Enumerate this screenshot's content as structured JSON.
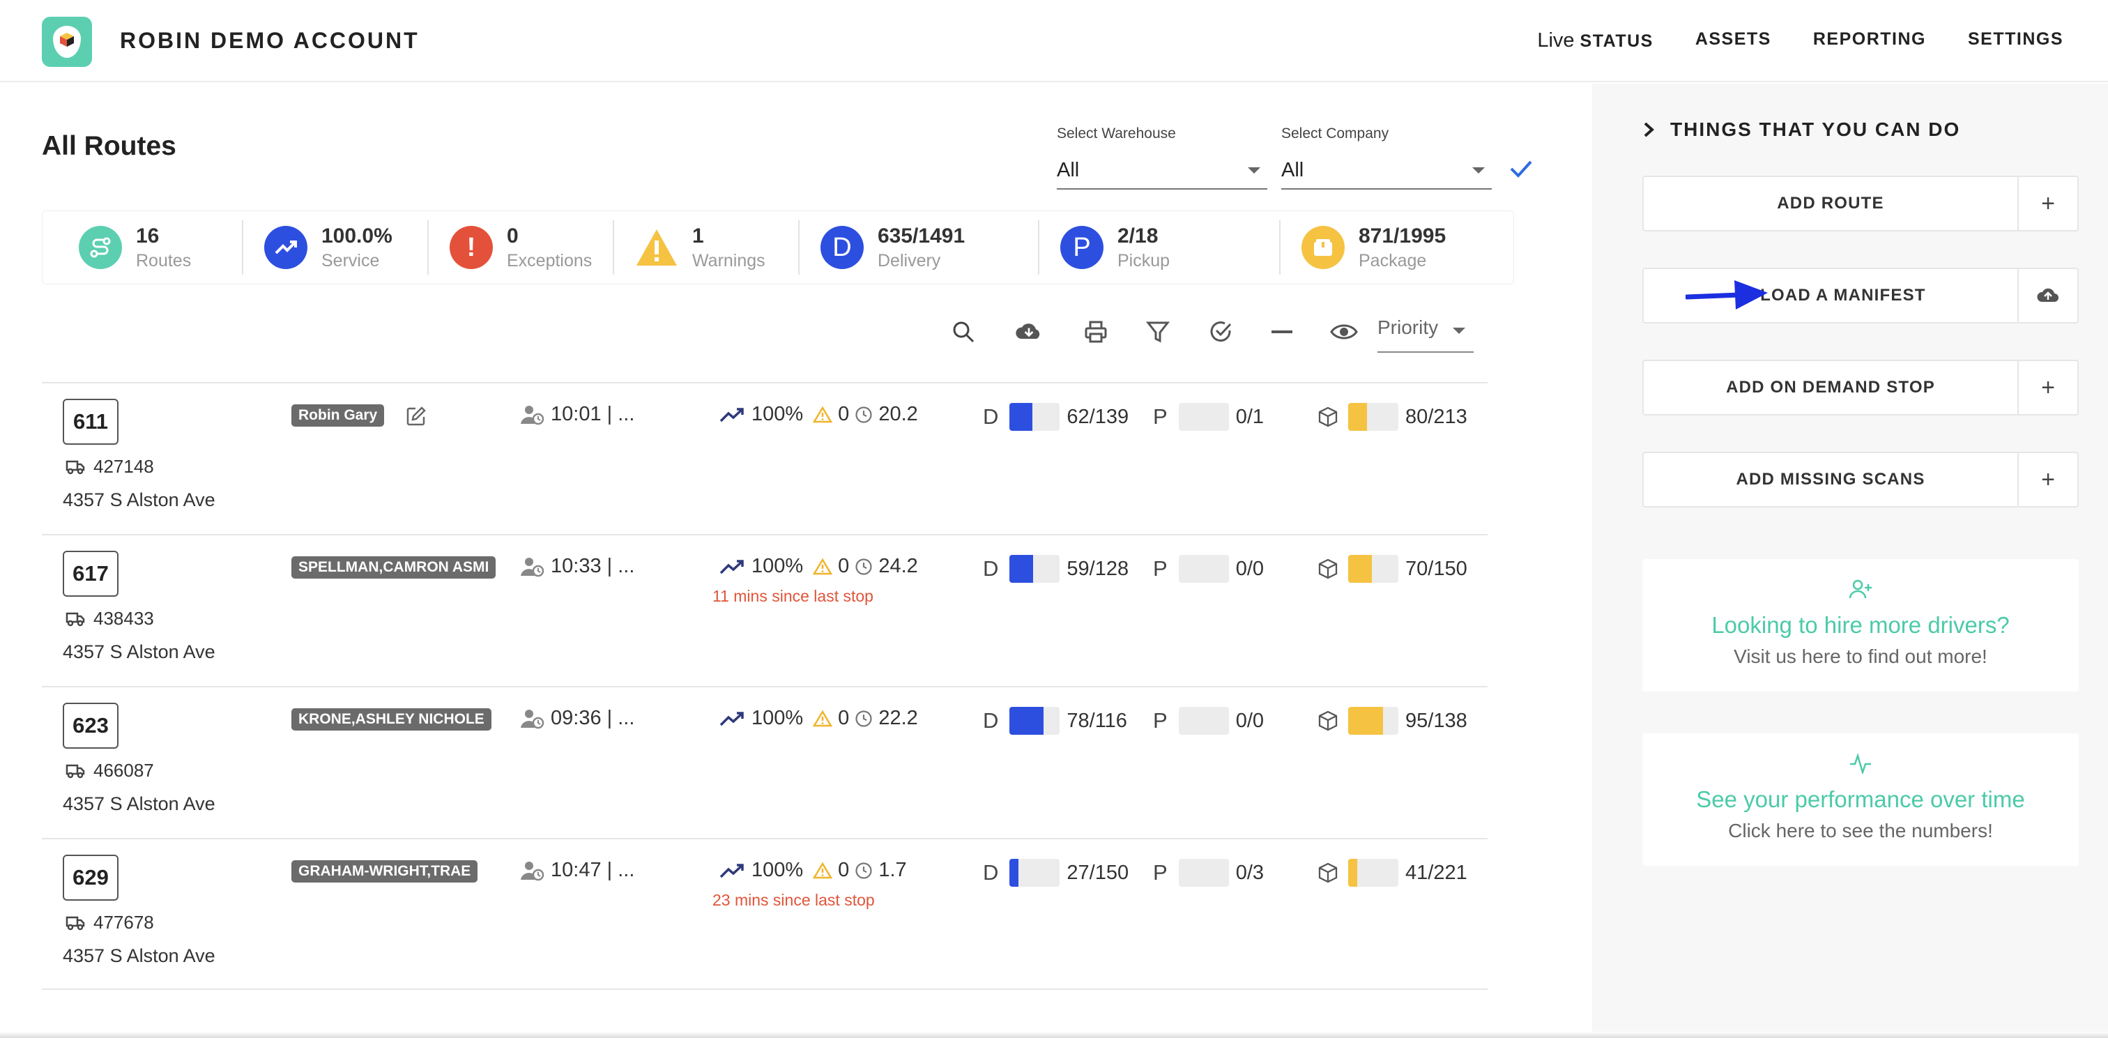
{
  "header": {
    "brand": "ROBIN DEMO ACCOUNT",
    "nav_live_prefix": "Live",
    "nav": [
      "STATUS",
      "ASSETS",
      "REPORTING",
      "SETTINGS"
    ]
  },
  "main": {
    "title": "All Routes",
    "warehouse": {
      "label": "Select Warehouse",
      "value": "All"
    },
    "company": {
      "label": "Select Company",
      "value": "All"
    },
    "priority": "Priority"
  },
  "stats": [
    {
      "value": "16",
      "label": "Routes",
      "icon": "route-icon",
      "color": "#5ccfb1"
    },
    {
      "value": "100.0%",
      "label": "Service",
      "icon": "trending-up-icon",
      "color": "#2d4fe0"
    },
    {
      "value": "0",
      "label": "Exceptions",
      "icon": "exclamation-icon",
      "color": "#e4513a"
    },
    {
      "value": "1",
      "label": "Warnings",
      "icon": "warning-icon",
      "color": "#f5c242"
    },
    {
      "value": "635/1491",
      "label": "Delivery",
      "icon": "D",
      "color": "#2d4fe0"
    },
    {
      "value": "2/18",
      "label": "Pickup",
      "icon": "P",
      "color": "#2d4fe0"
    },
    {
      "value": "871/1995",
      "label": "Package",
      "icon": "package-icon",
      "color": "#f5c242"
    }
  ],
  "rows": [
    {
      "route": "611",
      "truck": "427148",
      "address": "4357 S Alston Ave",
      "driver": "Robin Gary",
      "time": "10:01 | ...",
      "service": "100%",
      "warnings": "0",
      "hours": "20.2",
      "since": "",
      "delivery_letter": "D",
      "delivery": "62/139",
      "delivery_pct": 0.446,
      "pickup_letter": "P",
      "pickup": "0/1",
      "pickup_pct": 0,
      "package": "80/213",
      "package_pct": 0.376
    },
    {
      "route": "617",
      "truck": "438433",
      "address": "4357 S Alston Ave",
      "driver": "SPELLMAN,CAMRON ASMI",
      "time": "10:33 | ...",
      "service": "100%",
      "warnings": "0",
      "hours": "24.2",
      "since": "11 mins since last stop",
      "delivery_letter": "D",
      "delivery": "59/128",
      "delivery_pct": 0.461,
      "pickup_letter": "P",
      "pickup": "0/0",
      "pickup_pct": 0,
      "package": "70/150",
      "package_pct": 0.467
    },
    {
      "route": "623",
      "truck": "466087",
      "address": "4357 S Alston Ave",
      "driver": "KRONE,ASHLEY NICHOLE",
      "time": "09:36 | ...",
      "service": "100%",
      "warnings": "0",
      "hours": "22.2",
      "since": "",
      "delivery_letter": "D",
      "delivery": "78/116",
      "delivery_pct": 0.672,
      "pickup_letter": "P",
      "pickup": "0/0",
      "pickup_pct": 0,
      "package": "95/138",
      "package_pct": 0.688
    },
    {
      "route": "629",
      "truck": "477678",
      "address": "4357 S Alston Ave",
      "driver": "GRAHAM-WRIGHT,TRAE",
      "time": "10:47 | ...",
      "service": "100%",
      "warnings": "0",
      "hours": "1.7",
      "since": "23 mins since last stop",
      "delivery_letter": "D",
      "delivery": "27/150",
      "delivery_pct": 0.18,
      "pickup_letter": "P",
      "pickup": "0/3",
      "pickup_pct": 0,
      "package": "41/221",
      "package_pct": 0.186
    }
  ],
  "panel": {
    "title": "THINGS THAT YOU CAN DO",
    "actions": [
      {
        "label": "ADD ROUTE",
        "icon": "plus-icon"
      },
      {
        "label": "UPLOAD A MANIFEST",
        "icon": "cloud-upload-icon"
      },
      {
        "label": "ADD ON DEMAND STOP",
        "icon": "plus-icon"
      },
      {
        "label": "ADD MISSING SCANS",
        "icon": "plus-icon"
      }
    ],
    "promos": [
      {
        "title": "Looking to hire more drivers?",
        "subtitle": "Visit us here to find out more!",
        "icon": "add-user-icon"
      },
      {
        "title": "See your performance over time",
        "subtitle": "Click here to see the numbers!",
        "icon": "activity-icon"
      }
    ]
  },
  "colors": {
    "accent_teal": "#5ccfb1",
    "accent_blue": "#2d4fe0",
    "accent_yellow": "#f5c242",
    "alert_red": "#e4513a"
  }
}
